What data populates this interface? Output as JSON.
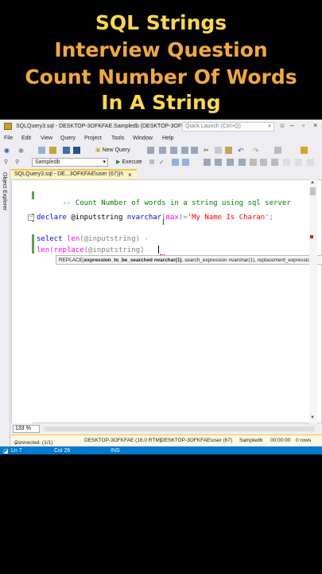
{
  "banner": {
    "line1": "SQL Strings",
    "line2": "Interview Question",
    "line3": "Count Number Of Words",
    "line4": "In A String"
  },
  "window": {
    "title": "SQLQuery3.sql - DESKTOP-3OFKFAE.Sampledb (DESKTOP-3OFKFAE...",
    "quick_launch_placeholder": "Quick Launch (Ctrl+Q)"
  },
  "menu": [
    "File",
    "Edit",
    "View",
    "Query",
    "Project",
    "Tools",
    "Window",
    "Help"
  ],
  "toolbar": {
    "new_query_label": "New Query",
    "database": "Sampledb",
    "execute_label": "Execute"
  },
  "object_explorer_label": "Object Explorer",
  "tab": {
    "label": "SQLQuery3.sql - DE...3OFKFAE\\user (67))*"
  },
  "editor": {
    "line1": "-- Count Number of words in a string using sql server",
    "line2_kw": "declare",
    "line2_var": " @inputstring ",
    "line2_type": "nvarchar",
    "line2_paren_open": "(",
    "line2_max": "max",
    "line2_paren_close": ")=",
    "line2_str": "'My Name Is Charan'",
    "line2_end": ";",
    "line3_kw": "select",
    "line3_fn": " len",
    "line3_rest": "(@inputstring)",
    "line3_tail": " -",
    "line4_fn": "len",
    "line4_p1": "(",
    "line4_fn2": "replace",
    "line4_rest": "(@inputstring)"
  },
  "tooltip": {
    "prefix": "REPLACE(",
    "bold_param": "expression_to_be_searched nvarchar(1)",
    "rest": ", search_expression nvarchar(1), replacement_expression n"
  },
  "status": {
    "zoom": "133 %",
    "connected": "Connected. (1/1)",
    "server": "DESKTOP-3OFKFAE (16.0 RTM)",
    "user": "DESKTOP-3OFKFAE\\user (67)",
    "database": "Sampledb",
    "elapsed": "00:00:00",
    "rows": "0 rows",
    "ln": "Ln 7",
    "col": "Col 26",
    "ins": "INS"
  },
  "colors": {
    "accent": "#007acc",
    "title_yellow": "#ffd84a",
    "title_orange": "#f2a93b"
  }
}
